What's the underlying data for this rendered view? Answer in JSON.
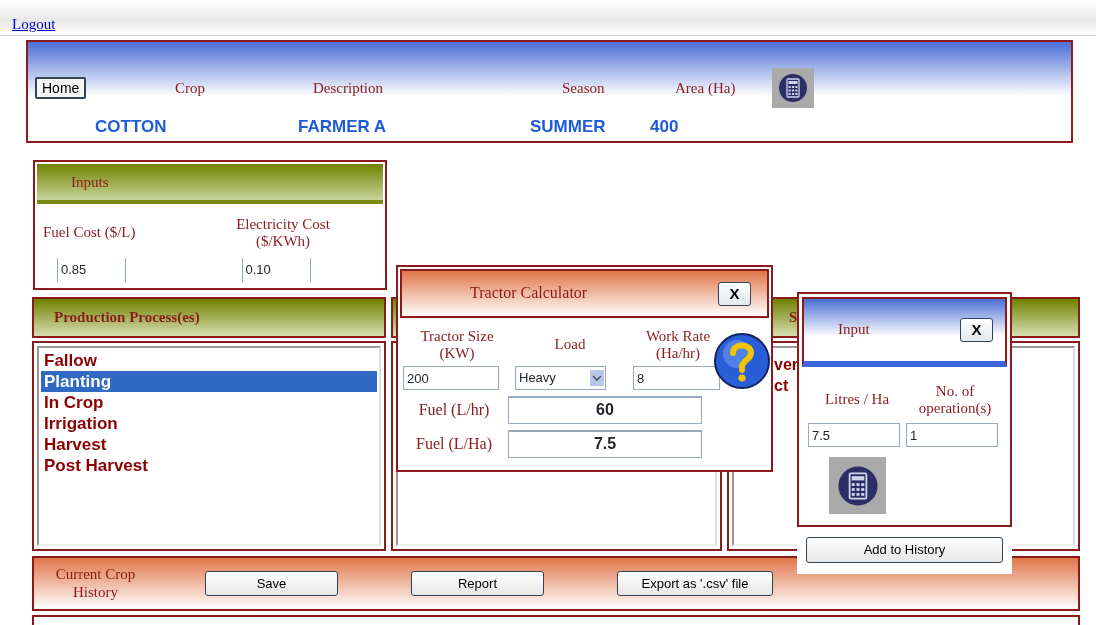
{
  "logout": "Logout",
  "header": {
    "home_button": "Home",
    "columns": [
      {
        "label": "Crop",
        "value": "COTTON"
      },
      {
        "label": "Description",
        "value": "FARMER A"
      },
      {
        "label": "Season",
        "value": "SUMMER"
      },
      {
        "label": "Area (Ha)",
        "value": "400"
      }
    ]
  },
  "inputs": {
    "title": "Inputs",
    "fields": [
      {
        "label": "Fuel Cost ($/L)",
        "value": "0.85"
      },
      {
        "label": "Electricity Cost ($/KWh)",
        "value": "0.10"
      }
    ]
  },
  "production": {
    "title": "Production Process(es)",
    "items": [
      {
        "label": "Fallow",
        "selected": false
      },
      {
        "label": "Planting",
        "selected": true
      },
      {
        "label": "In Crop",
        "selected": false
      },
      {
        "label": "Irrigation",
        "selected": false
      },
      {
        "label": "Harvest",
        "selected": false
      },
      {
        "label": "Post Harvest",
        "selected": false
      }
    ]
  },
  "right_panel": {
    "title": "S",
    "lines": [
      "ver",
      "ct"
    ]
  },
  "history": {
    "title": "Current Crop History",
    "buttons": [
      "Save",
      "Report",
      "Export as '.csv' file"
    ]
  },
  "tractor_calculator": {
    "title": "Tractor Calculator",
    "close": "X",
    "fields": [
      {
        "label": "Tractor Size (KW)",
        "value": "200",
        "kind": "text"
      },
      {
        "label": "Load",
        "value": "Heavy",
        "kind": "select"
      },
      {
        "label": "Work Rate (Ha/hr)",
        "value": "8",
        "kind": "text"
      }
    ],
    "results": [
      {
        "label": "Fuel (L/hr)",
        "value": "60"
      },
      {
        "label": "Fuel (L/Ha)",
        "value": "7.5"
      }
    ]
  },
  "input_dialog": {
    "title": "Input",
    "close": "X",
    "fields": [
      {
        "label": "Litres / Ha",
        "value": "7.5"
      },
      {
        "label": "No. of operation(s)",
        "value": "1"
      }
    ],
    "add_button": "Add to History"
  }
}
